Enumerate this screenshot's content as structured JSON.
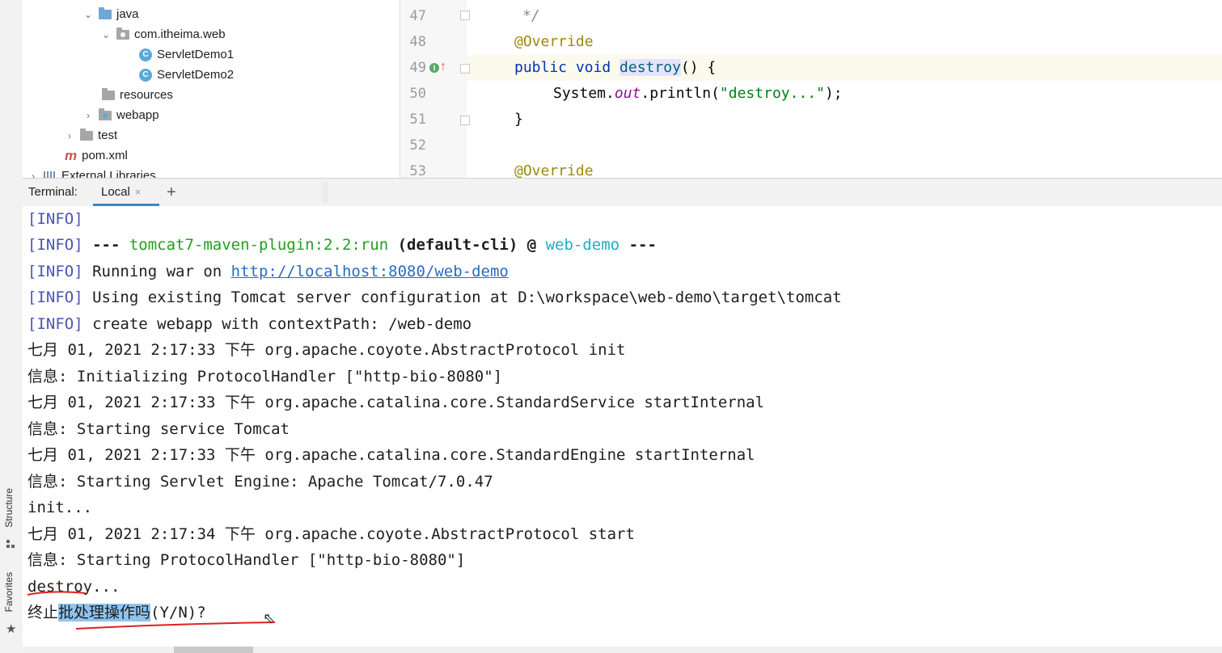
{
  "project_tree": {
    "items": [
      {
        "label": "java",
        "icon": "folder-source-icon"
      },
      {
        "label": "com.itheima.web",
        "icon": "package-icon"
      },
      {
        "label": "ServletDemo1",
        "icon": "java-class-icon"
      },
      {
        "label": "ServletDemo2",
        "icon": "java-class-icon"
      },
      {
        "label": "resources",
        "icon": "folder-resources-icon"
      },
      {
        "label": "webapp",
        "icon": "folder-web-icon"
      },
      {
        "label": "test",
        "icon": "folder-icon"
      },
      {
        "label": "pom.xml",
        "icon": "maven-icon"
      },
      {
        "label": "External Libraries",
        "icon": "libraries-icon"
      }
    ]
  },
  "editor": {
    "line_numbers": [
      "47",
      "48",
      "49",
      "50",
      "51",
      "52",
      "53"
    ],
    "lines": {
      "l47": "*/",
      "l48": "@Override",
      "l49_kw": "public void ",
      "l49_fn": "destroy",
      "l49_rest": "() {",
      "l50_a": "System.",
      "l50_fld": "out",
      "l50_b": ".println(",
      "l50_str": "\"destroy...\"",
      "l50_c": ");",
      "l51": "}",
      "l53": "@Override"
    }
  },
  "terminal": {
    "label": "Terminal:",
    "tab_local": "Local",
    "tab_close": "×",
    "add_tab": "+",
    "info_tag": "[INFO]",
    "plugin_prefix": " --- ",
    "plugin_name": "tomcat7-maven-plugin:2.2:run",
    "plugin_goal": " (default-cli) @ ",
    "plugin_project": "web-demo",
    "plugin_suffix": " ---",
    "running_war": " Running war on ",
    "running_url": "http://localhost:8080/web-demo",
    "using_existing": " Using existing Tomcat server configuration at D:\\workspace\\web-demo\\target\\tomcat",
    "create_webapp": " create webapp with contextPath: /web-demo",
    "log1": "七月 01, 2021 2:17:33 下午 org.apache.coyote.AbstractProtocol init",
    "log2": "信息: Initializing ProtocolHandler [\"http-bio-8080\"]",
    "log3": "七月 01, 2021 2:17:33 下午 org.apache.catalina.core.StandardService startInternal",
    "log4": "信息: Starting service Tomcat",
    "log5": "七月 01, 2021 2:17:33 下午 org.apache.catalina.core.StandardEngine startInternal",
    "log6": "信息: Starting Servlet Engine: Apache Tomcat/7.0.47",
    "log7": "init...",
    "log8": "七月 01, 2021 2:17:34 下午 org.apache.coyote.AbstractProtocol start",
    "log9": "信息: Starting ProtocolHandler [\"http-bio-8080\"]",
    "log10": "destroy...",
    "prompt_a": "终止",
    "prompt_sel": "批处理操作吗",
    "prompt_b": "(Y/N)?"
  },
  "side_tabs": {
    "structure": "Structure",
    "favorites": "Favorites"
  },
  "colors": {
    "accent": "#4083c9",
    "annotation_red": "#e02020",
    "selection": "#8fc3f0"
  }
}
